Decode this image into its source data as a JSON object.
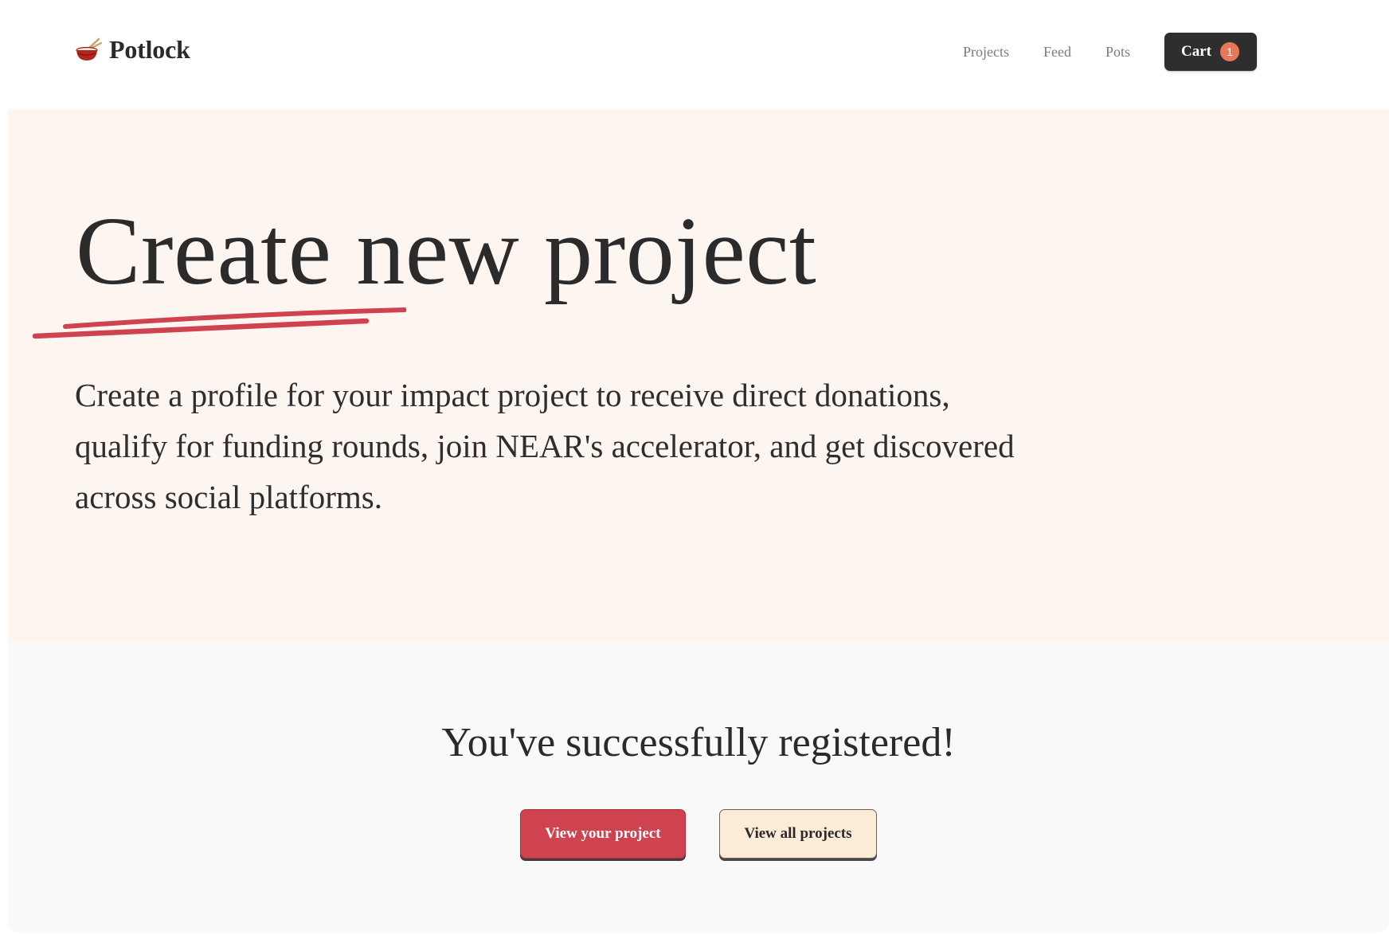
{
  "header": {
    "brand_name": "Potlock",
    "brand_icon": "pot-icon",
    "nav": [
      {
        "label": "Projects"
      },
      {
        "label": "Feed"
      },
      {
        "label": "Pots"
      }
    ],
    "cart": {
      "label": "Cart",
      "count": "1"
    }
  },
  "hero": {
    "title": "Create new project",
    "description": "Create a profile for your impact project to receive direct donations, qualify for funding rounds, join NEAR's accelerator, and get discovered across social platforms."
  },
  "success": {
    "heading": "You've successfully registered!",
    "primary_label": "View your project",
    "secondary_label": "View all projects"
  },
  "colors": {
    "accent": "#cf4350",
    "hero_background": "#fcf5f0",
    "cart_button": "#2e2e2e",
    "cart_badge": "#e8775a",
    "secondary_button": "#fcebd7"
  }
}
